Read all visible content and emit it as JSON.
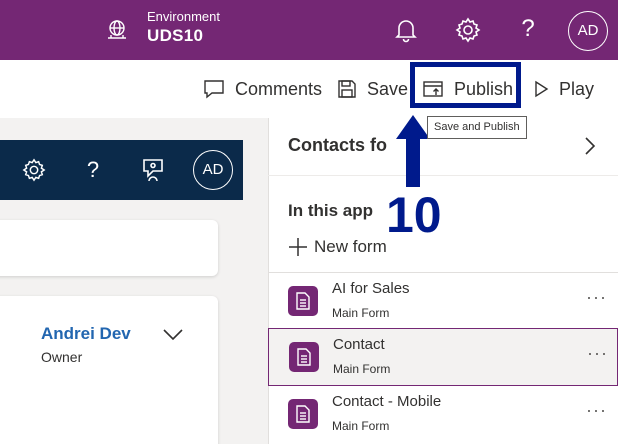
{
  "topbar": {
    "environment_label": "Environment",
    "environment_name": "UDS10",
    "avatar_initials": "AD",
    "help_glyph": "?",
    "icons": [
      "globe-icon",
      "bell-icon",
      "gear-icon",
      "help-icon"
    ],
    "color": "#742774"
  },
  "commandbar": {
    "comments_label": "Comments",
    "save_label": "Save",
    "publish_label": "Publish",
    "play_label": "Play",
    "tooltip": "Save and Publish"
  },
  "annotation": {
    "step_number": "10",
    "color": "#001a8c"
  },
  "preview": {
    "help_glyph": "?",
    "avatar_initials": "AD",
    "owner_name": "Andrei Dev",
    "owner_role": "Owner",
    "bar_color": "#0b2a4a",
    "accent": "#2266b0"
  },
  "panel": {
    "title": "Contacts fo",
    "section_label": "In this app",
    "new_form_label": "New form",
    "forms": [
      {
        "name": "AI for Sales",
        "type": "Main Form",
        "more": "···"
      },
      {
        "name": "Contact",
        "type": "Main Form",
        "more": "···"
      },
      {
        "name": "Contact - Mobile",
        "type": "Main Form",
        "more": "···"
      }
    ]
  }
}
